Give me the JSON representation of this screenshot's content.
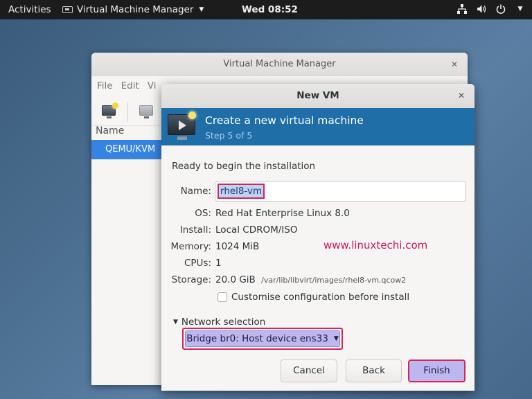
{
  "topbar": {
    "activities": "Activities",
    "app_name": "Virtual Machine Manager",
    "clock": "Wed 08:52"
  },
  "vmm_window": {
    "title": "Virtual Machine Manager",
    "menu": [
      "File",
      "Edit",
      "Vi"
    ],
    "list_header": "Name",
    "connection": "QEMU/KVM"
  },
  "dialog": {
    "title": "New VM",
    "banner_title": "Create a new virtual machine",
    "banner_step": "Step 5 of 5",
    "ready_text": "Ready to begin the installation",
    "name_label": "Name:",
    "name_value": "rhel8-vm",
    "os_label": "OS:",
    "os_value": "Red Hat Enterprise Linux 8.0",
    "install_label": "Install:",
    "install_value": "Local CDROM/ISO",
    "memory_label": "Memory:",
    "memory_value": "1024 MiB",
    "cpus_label": "CPUs:",
    "cpus_value": "1",
    "storage_label": "Storage:",
    "storage_value": "20.0 GiB",
    "storage_path": "/var/lib/libvirt/images/rhel8-vm.qcow2",
    "customise_label": "Customise configuration before install",
    "customise_checked": false,
    "network_label": "Network selection",
    "network_value": "Bridge br0: Host device ens33",
    "cancel_label": "Cancel",
    "back_label": "Back",
    "finish_label": "Finish"
  },
  "watermark": "www.linuxtechi.com",
  "colors": {
    "banner": "#1f6ea8",
    "selection": "#3584e4",
    "highlight_border": "#d6245a",
    "watermark": "#c8175a"
  }
}
